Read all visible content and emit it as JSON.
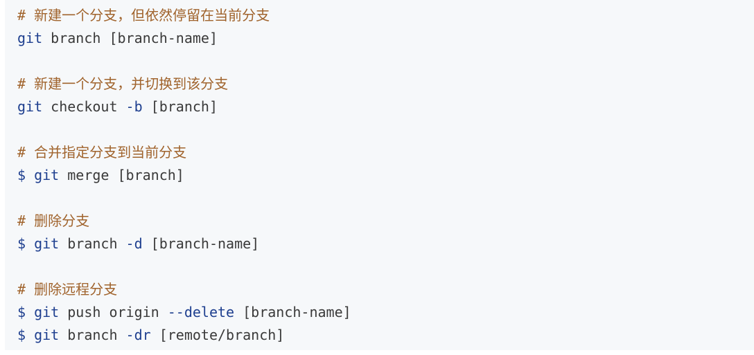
{
  "code_block": {
    "lines": [
      {
        "comment": "# 新建一个分支，但依然停留在当前分支"
      },
      {
        "cmd": "git",
        "rest": " branch [branch-name]"
      },
      {
        "comment": "# 新建一个分支，并切换到该分支"
      },
      {
        "cmd": "git",
        "rest": " checkout ",
        "flag": "-b",
        "rest2": " [branch]"
      },
      {
        "comment": "# 合并指定分支到当前分支"
      },
      {
        "prompt": "$",
        "cmd": "git",
        "rest": " merge [branch]"
      },
      {
        "comment": "# 删除分支"
      },
      {
        "prompt": "$",
        "cmd": "git",
        "rest": " branch ",
        "flag": "-d",
        "rest2": " [branch-name]"
      },
      {
        "comment": "# 删除远程分支"
      },
      {
        "prompt": "$",
        "cmd": "git",
        "rest": " push origin ",
        "flag": "--delete",
        "rest2": " [branch-name]"
      },
      {
        "prompt": "$",
        "cmd": "git",
        "rest": " branch ",
        "flag": "-dr",
        "rest2": " [remote/branch]"
      }
    ]
  },
  "colors": {
    "background": "#f6f8fa",
    "comment": "#a0632c",
    "keyword": "#1e3f8f",
    "text": "#3a3a3a"
  }
}
